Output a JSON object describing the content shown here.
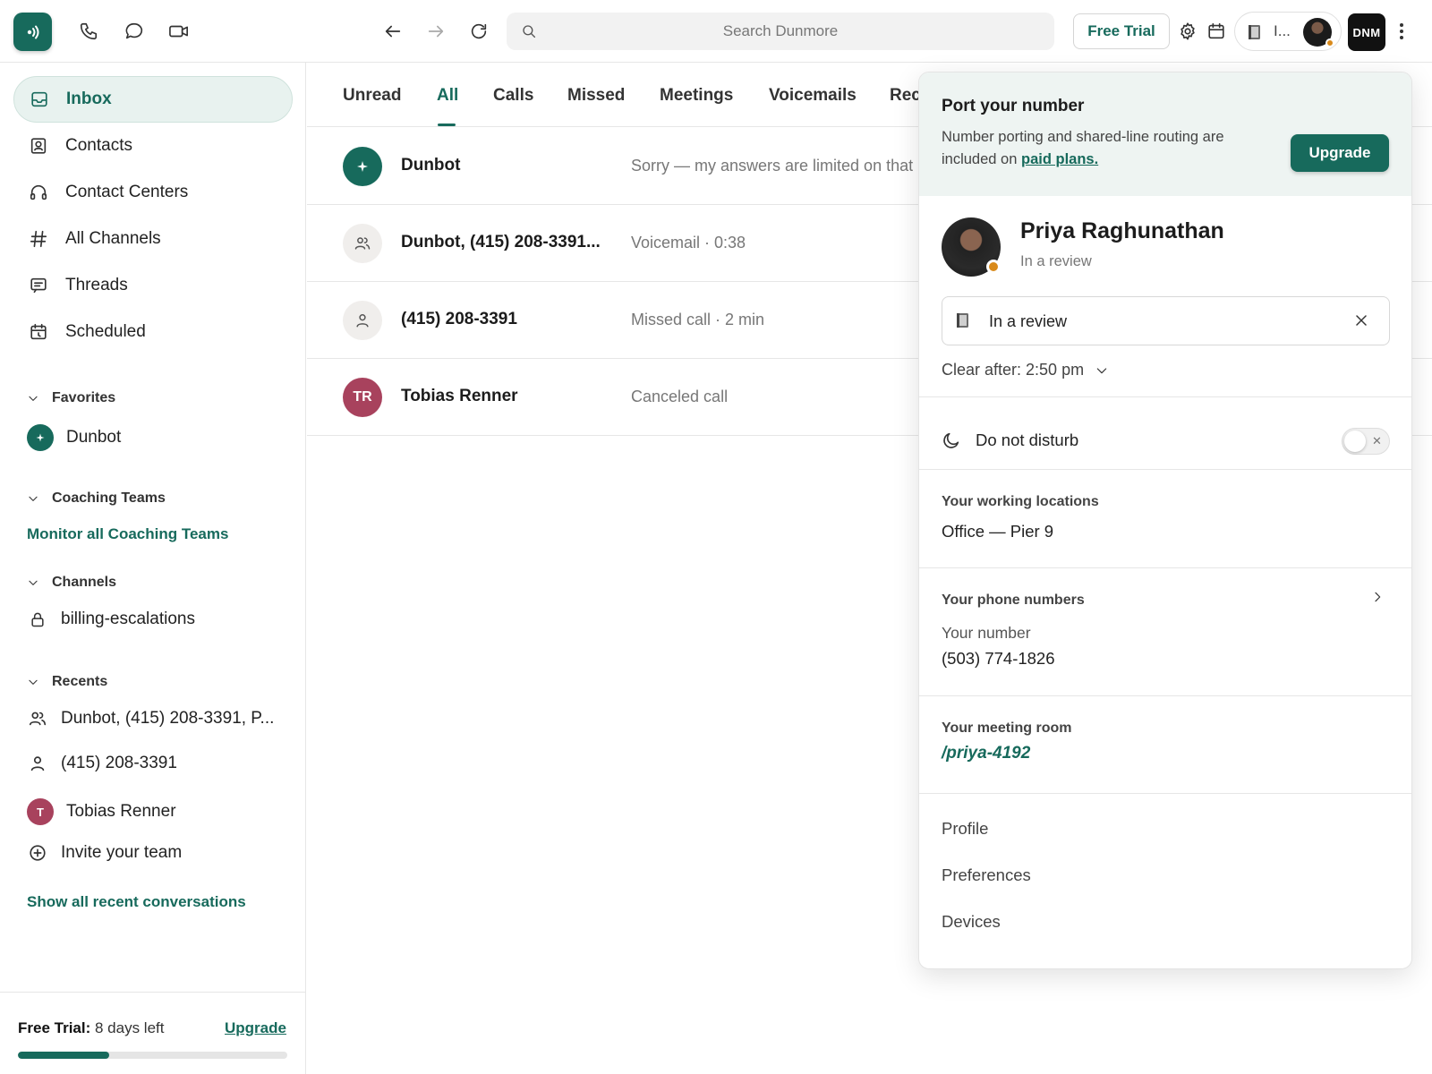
{
  "topbar": {
    "search_placeholder": "Search Dunmore",
    "free_trial_label": "Free Trial",
    "status_pill_text": "I...",
    "account_badge": "DNM",
    "icons": [
      "phone-icon",
      "chat-icon",
      "video-icon",
      "back-arrow-icon",
      "forward-arrow-icon",
      "refresh-icon",
      "gear-icon",
      "calendar-icon",
      "more-icon"
    ]
  },
  "sidebar": {
    "nav": [
      {
        "label": "Inbox",
        "icon": "inbox-icon",
        "active": true
      },
      {
        "label": "Contacts",
        "icon": "contacts-icon"
      },
      {
        "label": "Contact Centers",
        "icon": "headset-icon"
      },
      {
        "label": "All Channels",
        "icon": "hash-icon"
      },
      {
        "label": "Threads",
        "icon": "threads-icon"
      },
      {
        "label": "Scheduled",
        "icon": "scheduled-icon"
      }
    ],
    "favorites": {
      "title": "Favorites",
      "items": [
        {
          "label": "Dunbot"
        }
      ]
    },
    "coaching": {
      "title": "Coaching Teams",
      "link": "Monitor all Coaching Teams"
    },
    "channels": {
      "title": "Channels",
      "items": [
        {
          "label": "billing-escalations"
        }
      ]
    },
    "recents": {
      "title": "Recents",
      "items": [
        {
          "label": "Dunbot, (415) 208-3391, P..."
        },
        {
          "label": "(415) 208-3391"
        },
        {
          "label": "Tobias Renner",
          "initial": "T"
        },
        {
          "label": "Invite your team"
        }
      ],
      "show_all": "Show all recent conversations"
    },
    "trial": {
      "label_bold": "Free Trial:",
      "label_rest": " 8 days left",
      "upgrade": "Upgrade",
      "progress_fraction": 0.34
    }
  },
  "main": {
    "tabs": [
      "Unread",
      "All",
      "Calls",
      "Missed",
      "Meetings",
      "Voicemails",
      "Rec"
    ],
    "active_tab": "All",
    "rows": [
      {
        "name": "Dunbot",
        "preview": "Sorry — my answers are limited on that",
        "avatar": "dunbot"
      },
      {
        "name": "Dunbot, (415) 208-3391...",
        "preview": "Voicemail · 0:38",
        "avatar": "group"
      },
      {
        "name": "(415) 208-3391",
        "preview": "Missed call · 2 min",
        "avatar": "person"
      },
      {
        "name": "Tobias Renner",
        "preview": "Canceled call",
        "avatar": "initials",
        "initials": "TR"
      }
    ]
  },
  "popover": {
    "port": {
      "title": "Port your number",
      "desc": "Number porting and shared-line routing are included on ",
      "link": "paid plans.",
      "button": "Upgrade"
    },
    "profile": {
      "name": "Priya Raghunathan",
      "status": "In a review"
    },
    "status_value": "In a review",
    "clear_after": "Clear after: 2:50 pm",
    "dnd": {
      "label": "Do not disturb",
      "enabled": false
    },
    "locations": {
      "title": "Your working locations",
      "value": "Office — Pier 9"
    },
    "phones": {
      "title": "Your phone numbers",
      "sub": "Your number",
      "value": "(503) 774-1826"
    },
    "room": {
      "title": "Your meeting room",
      "value": "/priya-4192"
    },
    "menu": [
      "Profile",
      "Preferences",
      "Devices"
    ]
  },
  "colors": {
    "accent": "#176a5c",
    "status_dot": "#d98a1b",
    "tobias_avatar": "#a8425d"
  }
}
